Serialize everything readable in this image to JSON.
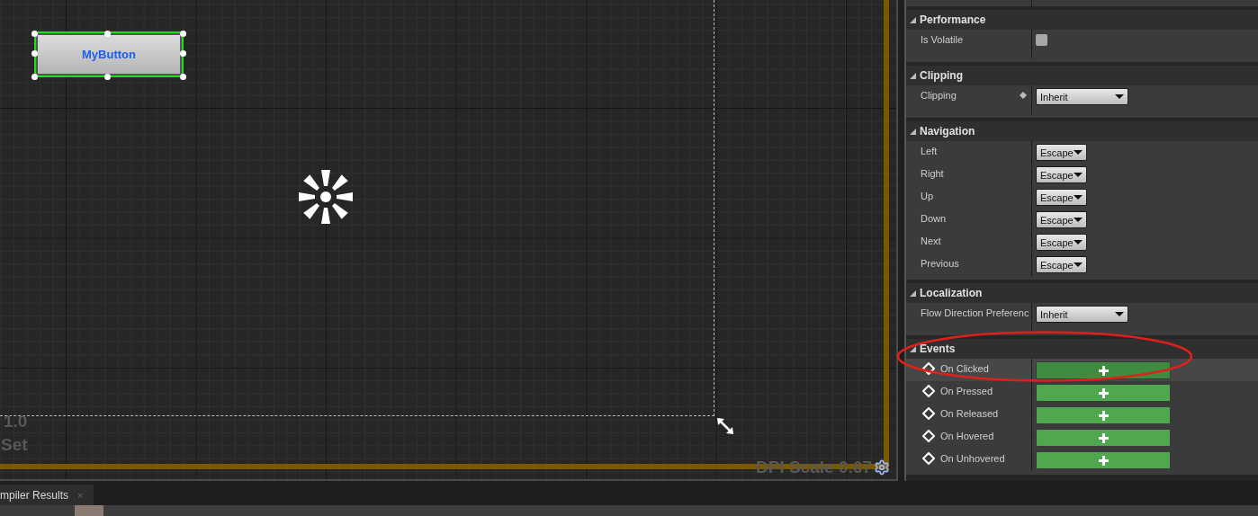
{
  "designer": {
    "widget": {
      "label": "MyButton",
      "selected": true
    },
    "zoom_text": "1.0",
    "mode_text": "Set",
    "dpi_scale": "DPI Scale 0.67"
  },
  "details": {
    "sections": [
      {
        "title": "Performance",
        "expanded": true,
        "rows": [
          {
            "kind": "checkbox",
            "label": "Is Volatile",
            "checked": false
          }
        ]
      },
      {
        "title": "Clipping",
        "expanded": true,
        "rows": [
          {
            "kind": "combo",
            "label": "Clipping",
            "value": "Inherit",
            "override_icon": true
          }
        ]
      },
      {
        "title": "Navigation",
        "expanded": true,
        "rows": [
          {
            "kind": "nav",
            "label": "Left",
            "value": "Escape"
          },
          {
            "kind": "nav",
            "label": "Right",
            "value": "Escape"
          },
          {
            "kind": "nav",
            "label": "Up",
            "value": "Escape"
          },
          {
            "kind": "nav",
            "label": "Down",
            "value": "Escape"
          },
          {
            "kind": "nav",
            "label": "Next",
            "value": "Escape"
          },
          {
            "kind": "nav",
            "label": "Previous",
            "value": "Escape"
          }
        ]
      },
      {
        "title": "Localization",
        "expanded": true,
        "rows": [
          {
            "kind": "combo",
            "label": "Flow Direction Preferenc",
            "value": "Inherit",
            "override_icon": false
          }
        ]
      },
      {
        "title": "Events",
        "expanded": true,
        "rows": [
          {
            "kind": "event",
            "label": "On Clicked",
            "highlighted": true
          },
          {
            "kind": "event",
            "label": "On Pressed",
            "highlighted": false
          },
          {
            "kind": "event",
            "label": "On Released",
            "highlighted": false
          },
          {
            "kind": "event",
            "label": "On Hovered",
            "highlighted": false
          },
          {
            "kind": "event",
            "label": "On Unhovered",
            "highlighted": false
          }
        ]
      }
    ]
  },
  "bottom_tabs": [
    {
      "label": "mpiler Results",
      "close": "×"
    }
  ]
}
